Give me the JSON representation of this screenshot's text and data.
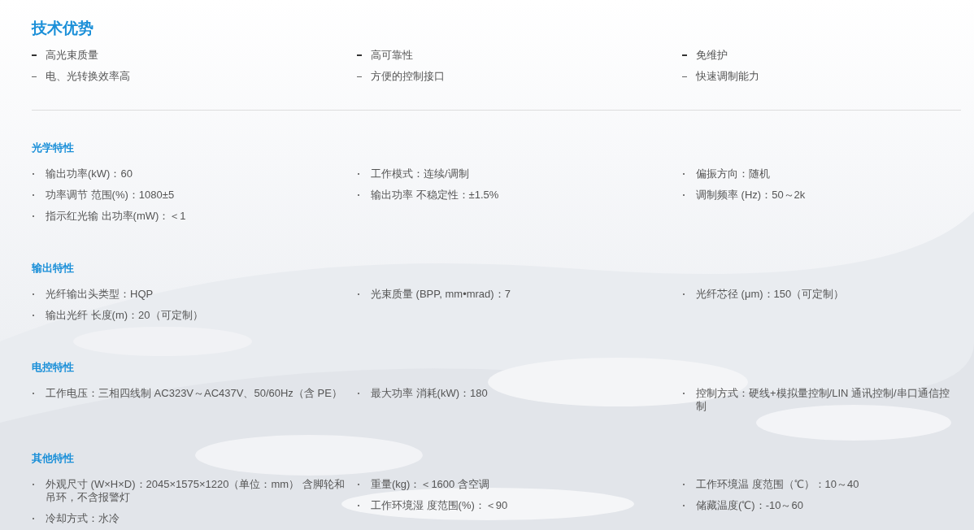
{
  "title": "技术优势",
  "advantages": [
    [
      "高光束质量",
      "电、光转换效率高"
    ],
    [
      "高可靠性",
      "方便的控制接口"
    ],
    [
      "免维护",
      "快速调制能力"
    ]
  ],
  "sections": [
    {
      "heading": "光学特性",
      "columns": [
        [
          "输出功率(kW)：60",
          "功率调节 范围(%)：1080±5",
          "指示红光输 出功率(mW)：＜1"
        ],
        [
          "工作模式：连续/调制",
          "输出功率 不稳定性：±1.5%"
        ],
        [
          "偏振方向：随机",
          "调制频率 (Hz)：50～2k"
        ]
      ]
    },
    {
      "heading": "输出特性",
      "columns": [
        [
          "光纤输出头类型：HQP",
          "输出光纤 长度(m)：20（可定制）"
        ],
        [
          "光束质量 (BPP, mm•mrad)：7"
        ],
        [
          "光纤芯径 (μm)：150（可定制）"
        ]
      ]
    },
    {
      "heading": "电控特性",
      "columns": [
        [
          "工作电压：三相四线制 AC323V～AC437V、50/60Hz（含 PE）"
        ],
        [
          "最大功率 消耗(kW)：180"
        ],
        [
          "控制方式：硬线+模拟量控制/LIN 通讯控制/串口通信控制"
        ]
      ]
    },
    {
      "heading": "其他特性",
      "columns": [
        [
          "外观尺寸 (W×H×D)：2045×1575×1220（单位：mm） 含脚轮和吊环，不含报警灯",
          "冷却方式：水冷"
        ],
        [
          "重量(kg)：＜1600 含空调",
          "工作环境湿 度范围(%)：＜90"
        ],
        [
          "工作环境温 度范围（℃）：10～40",
          "储藏温度(℃)：-10～60"
        ]
      ]
    }
  ]
}
